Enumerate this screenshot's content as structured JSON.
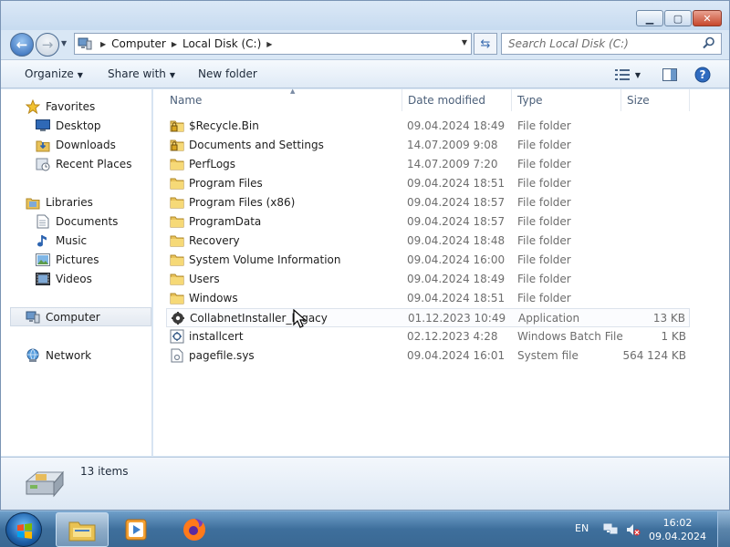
{
  "window": {
    "address": [
      "Computer",
      "Local Disk (C:)"
    ],
    "search_placeholder": "Search Local Disk (C:)"
  },
  "toolbar": {
    "organize": "Organize",
    "share_with": "Share with",
    "new_folder": "New folder"
  },
  "navpane": {
    "favorites": "Favorites",
    "desktop": "Desktop",
    "downloads": "Downloads",
    "recent_places": "Recent Places",
    "libraries": "Libraries",
    "documents": "Documents",
    "music": "Music",
    "pictures": "Pictures",
    "videos": "Videos",
    "computer": "Computer",
    "network": "Network"
  },
  "columns": {
    "name": "Name",
    "date": "Date modified",
    "type": "Type",
    "size": "Size"
  },
  "files": [
    {
      "name": "$Recycle.Bin",
      "date": "09.04.2024 18:49",
      "type": "File folder",
      "size": "",
      "icon": "locked-folder-icon"
    },
    {
      "name": "Documents and Settings",
      "date": "14.07.2009 9:08",
      "type": "File folder",
      "size": "",
      "icon": "locked-folder-icon"
    },
    {
      "name": "PerfLogs",
      "date": "14.07.2009 7:20",
      "type": "File folder",
      "size": "",
      "icon": "folder-icon"
    },
    {
      "name": "Program Files",
      "date": "09.04.2024 18:51",
      "type": "File folder",
      "size": "",
      "icon": "folder-icon"
    },
    {
      "name": "Program Files (x86)",
      "date": "09.04.2024 18:57",
      "type": "File folder",
      "size": "",
      "icon": "folder-icon"
    },
    {
      "name": "ProgramData",
      "date": "09.04.2024 18:57",
      "type": "File folder",
      "size": "",
      "icon": "folder-icon"
    },
    {
      "name": "Recovery",
      "date": "09.04.2024 18:48",
      "type": "File folder",
      "size": "",
      "icon": "folder-icon"
    },
    {
      "name": "System Volume Information",
      "date": "09.04.2024 16:00",
      "type": "File folder",
      "size": "",
      "icon": "folder-icon"
    },
    {
      "name": "Users",
      "date": "09.04.2024 18:49",
      "type": "File folder",
      "size": "",
      "icon": "folder-icon"
    },
    {
      "name": "Windows",
      "date": "09.04.2024 18:51",
      "type": "File folder",
      "size": "",
      "icon": "folder-icon"
    },
    {
      "name": "CollabnetInstaller_legacy",
      "date": "01.12.2023 10:49",
      "type": "Application",
      "size": "13 KB",
      "icon": "application-icon"
    },
    {
      "name": "installcert",
      "date": "02.12.2023 4:28",
      "type": "Windows Batch File",
      "size": "1 KB",
      "icon": "batch-file-icon"
    },
    {
      "name": "pagefile.sys",
      "date": "09.04.2024 16:01",
      "type": "System file",
      "size": "564 124 KB",
      "icon": "system-file-icon"
    }
  ],
  "details": {
    "count": "13 items"
  },
  "taskbar": {
    "lang": "EN",
    "time": "16:02",
    "date": "09.04.2024"
  }
}
